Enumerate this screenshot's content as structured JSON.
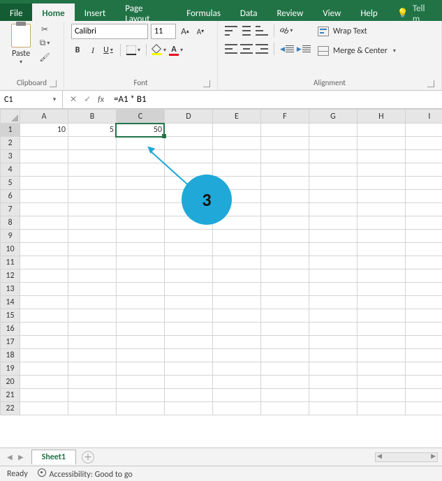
{
  "tabs": {
    "file": "File",
    "items": [
      "Home",
      "Insert",
      "Page Layout",
      "Formulas",
      "Data",
      "Review",
      "View",
      "Help"
    ],
    "active_index": 0,
    "tellme": "Tell m"
  },
  "ribbon": {
    "clipboard": {
      "paste": "Paste",
      "label": "Clipboard"
    },
    "font": {
      "name": "Calibri",
      "size": "11",
      "label": "Font",
      "bold": "B",
      "italic": "I",
      "underline": "U",
      "incA": "A",
      "decA": "A",
      "colorA": "A"
    },
    "alignment": {
      "wrap": "Wrap Text",
      "merge": "Merge & Center",
      "label": "Alignment"
    }
  },
  "formula_bar": {
    "cell_ref": "C1",
    "formula": "=A1 * B1",
    "fx": "fx"
  },
  "grid": {
    "columns": [
      "A",
      "B",
      "C",
      "D",
      "E",
      "F",
      "G",
      "H",
      "I"
    ],
    "row_count": 22,
    "selected_cell": "C1",
    "cells": {
      "A1": "10",
      "B1": "5",
      "C1": "50"
    }
  },
  "sheets": {
    "active": "Sheet1"
  },
  "status": {
    "ready": "Ready",
    "accessibility": "Accessibility: Good to go"
  },
  "annotation": {
    "num": "3"
  }
}
